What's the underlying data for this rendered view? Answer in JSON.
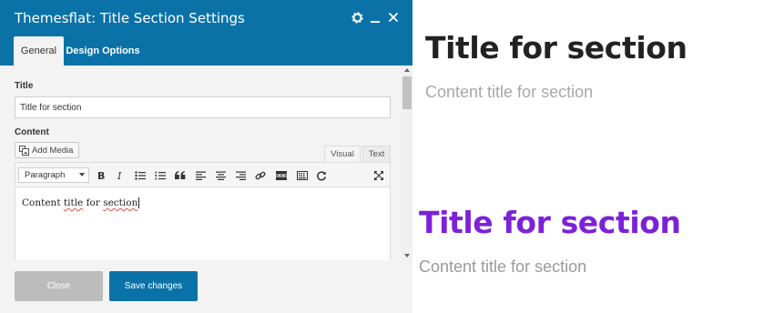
{
  "modal": {
    "title": "Themesflat: Title Section Settings",
    "header_icons": [
      "gear-icon",
      "minimize-icon",
      "close-icon"
    ],
    "tabs": [
      {
        "label": "General",
        "active": true
      },
      {
        "label": "Design Options",
        "active": false
      }
    ],
    "fields": {
      "title_label": "Title",
      "title_value": "Title for section",
      "content_label": "Content"
    },
    "editor": {
      "add_media_label": "Add Media",
      "mode_tabs": [
        "Visual",
        "Text"
      ],
      "active_mode": "Visual",
      "format_select": "Paragraph",
      "toolbar_icons": [
        "bold-icon",
        "italic-icon",
        "bullet-list-icon",
        "numbered-list-icon",
        "blockquote-icon",
        "align-left-icon",
        "align-center-icon",
        "align-right-icon",
        "link-icon",
        "read-more-icon",
        "toolbar-toggle-icon",
        "fullscreen-icon"
      ],
      "content": {
        "word1": "Content",
        "word2": "title",
        "word3": "for",
        "word4": "section"
      }
    },
    "footer": {
      "close_label": "Close",
      "save_label": "Save changes"
    }
  },
  "preview": [
    {
      "title": "Title for section",
      "subtitle": "Content title for section",
      "title_color": "#222222"
    },
    {
      "title": "Title for section",
      "subtitle": "Content title for section",
      "title_color": "#7d21d9"
    }
  ],
  "colors": {
    "header": "#0b72a8",
    "primary_button": "#0b72a8",
    "close_button": "#bcbcbc",
    "accent_title": "#7d21d9"
  }
}
